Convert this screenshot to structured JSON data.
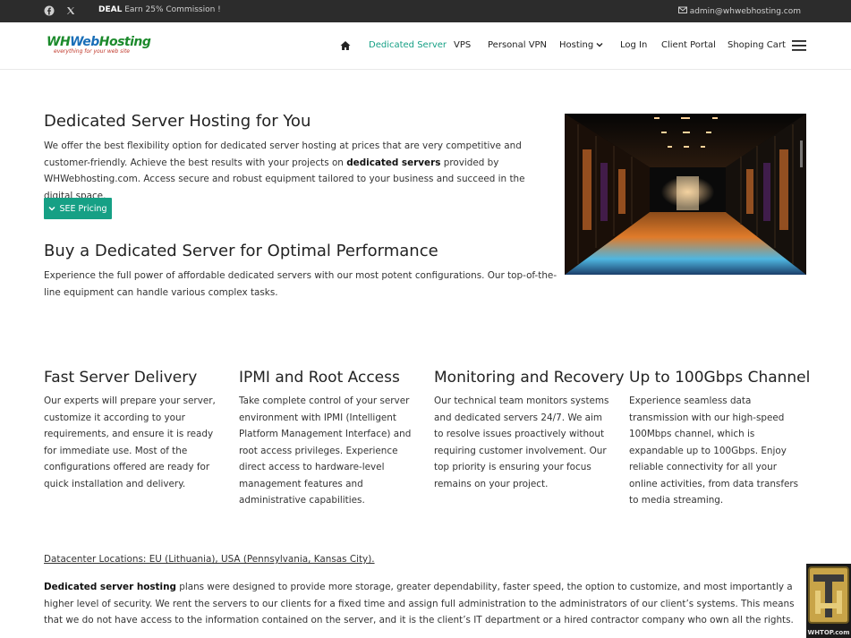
{
  "topbar": {
    "social_icons": [
      "facebook-icon",
      "x-twitter-icon"
    ],
    "deal_bold": "DEAL",
    "deal_text": "Earn 25% Commission !",
    "email_icon": "envelope-icon",
    "email": "admin@whwebhosting.com"
  },
  "logo": {
    "part1": "WH",
    "part2": "Web",
    "part3": "Hosting",
    "tagline": "everything for your web site"
  },
  "nav": {
    "home_icon": "home-icon",
    "items": [
      "Dedicated Server",
      "VPS",
      "Personal VPN",
      "Hosting",
      "Log In",
      "Client Portal",
      "Shoping Cart"
    ],
    "active": "Dedicated Server",
    "menu_icon": "hamburger-icon"
  },
  "intro": {
    "title": "Dedicated Server Hosting for You",
    "text_before": "We offer the best flexibility option for dedicated server hosting at prices that are very competitive and customer-friendly. Achieve the best results with your projects on ",
    "text_bold": "dedicated servers",
    "text_after": " provided by WHWebhosting.com. Access secure and robust equipment tailored to your business and succeed in the digital space.",
    "button_label": "SEE Pricing"
  },
  "buy": {
    "title": "Buy a Dedicated Server for Optimal Performance",
    "text": "Experience the full power of affordable dedicated servers with our most potent configurations. Our top-of-the-line equipment can handle various complex tasks."
  },
  "features": [
    {
      "title": "Fast Server Delivery",
      "text": "Our experts will prepare your server, customize it according to your requirements, and ensure it is ready for immediate use. Most of the configurations offered are ready for quick installation and delivery."
    },
    {
      "title": "IPMI and Root Access",
      "text": "Take complete control of your server environment with IPMI (Intelligent Platform Management Interface) and root access privileges. Experience direct access to hardware-level management features and administrative capabilities."
    },
    {
      "title": "Monitoring and Recovery",
      "text": "Our technical team monitors systems and dedicated servers 24/7. We aim to resolve issues proactively without requiring customer involvement. Our top priority is ensuring your focus remains on your project."
    },
    {
      "title": "Up to 100Gbps Channel",
      "text": "Experience seamless data transmission with our high-speed 100Mbps channel, which is expandable up to 100Gbps. Enjoy reliable connectivity for all your online activities, from data transfers to media streaming."
    }
  ],
  "datacenter": "Datacenter Locations: EU (Lithuania), USA (Pennsylvania, Kansas City).",
  "bottom": {
    "bold": "Dedicated server hosting",
    "text": " plans were designed to provide more storage, greater dependability, faster speed, the option to customize, and most importantly a higher level of security. We rent the servers to our clients for a fixed time and assign full administration to the administrators of our client’s systems. This means that we do not have access to the information contained on the server, and it is the client’s IT department or a hired contractor company who own all the rights."
  },
  "watermark": {
    "site": "WHTOP.com"
  },
  "colors": {
    "accent": "#16a085",
    "topbar_bg": "#2c2c2c"
  }
}
